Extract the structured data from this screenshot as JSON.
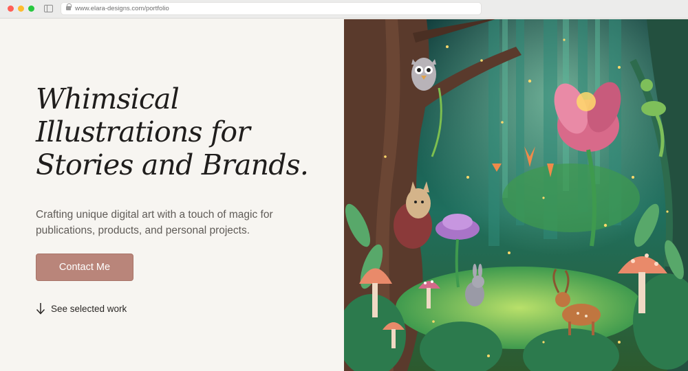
{
  "browser": {
    "url": "www.elara-designs.com/portfolio",
    "icons": [
      "close-dot",
      "minimize-dot",
      "zoom-dot",
      "sidebar-icon",
      "lock-icon"
    ]
  },
  "hero": {
    "title_lines": [
      "Whimsical",
      "Illustrations for",
      "Stories and Brands."
    ],
    "subtitle_lines": [
      "Crafting unique digital art with a touch of magic for",
      "publications, products, and personal projects."
    ],
    "cta_label": "Contact Me",
    "secondary_link_label": "See selected work",
    "secondary_link_icon": "arrow-down-icon"
  },
  "illustration": {
    "subject": "whimsical-forest-illustration",
    "colors": {
      "deep": "#0f3b3a",
      "teal": "#1f6f5e",
      "green": "#3f9a4e",
      "moss": "#7dbf4f",
      "trunk": "#5a3a2c",
      "pink": "#d86a8a",
      "mushroom": "#e98a6a",
      "glow": "#ffd96b"
    }
  },
  "theme": {
    "background": "#f7f5f1",
    "accent": "#b9857a",
    "text": "#1f1d1c",
    "muted": "#5f5b57"
  }
}
